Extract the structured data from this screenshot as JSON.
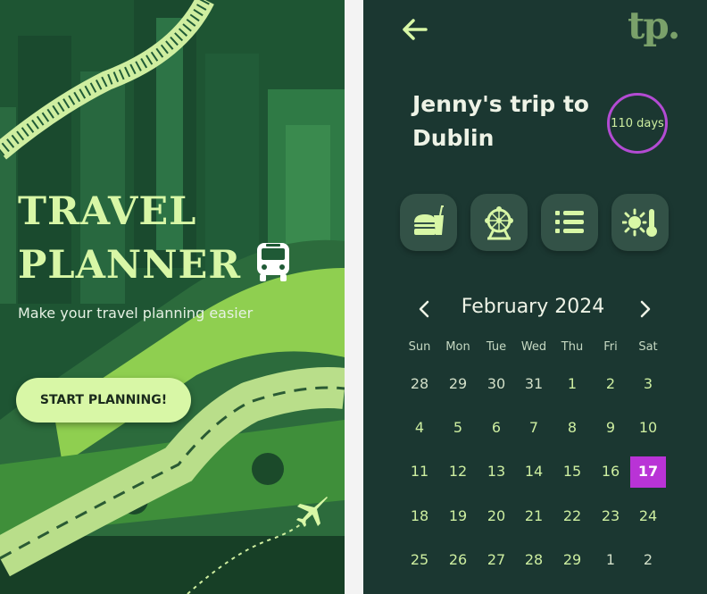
{
  "poster": {
    "title_line1": "TRAVEL",
    "title_line2": "PLANNER",
    "subtitle": "Make your travel planning easier",
    "cta_label": "START PLANNING!",
    "icons": [
      "bus-icon",
      "airplane-icon"
    ]
  },
  "app": {
    "logo": "tp.",
    "trip_title": "Jenny's trip to Dublin",
    "countdown": "110 days",
    "categories": [
      {
        "name": "food",
        "icon": "burger-drink-icon"
      },
      {
        "name": "attractions",
        "icon": "ferris-wheel-icon"
      },
      {
        "name": "list",
        "icon": "list-icon"
      },
      {
        "name": "weather",
        "icon": "sun-thermometer-icon"
      }
    ],
    "calendar": {
      "month_label": "February 2024",
      "weekdays": [
        "Sun",
        "Mon",
        "Tue",
        "Wed",
        "Thu",
        "Fri",
        "Sat"
      ],
      "weeks": [
        [
          "28",
          "29",
          "30",
          "31",
          "1",
          "2",
          "3"
        ],
        [
          "4",
          "5",
          "6",
          "7",
          "8",
          "9",
          "10"
        ],
        [
          "11",
          "12",
          "13",
          "14",
          "15",
          "16",
          "17"
        ],
        [
          "18",
          "19",
          "20",
          "21",
          "22",
          "23",
          "24"
        ],
        [
          "25",
          "26",
          "27",
          "28",
          "29",
          "1",
          "2"
        ]
      ],
      "selected_day": "17"
    }
  },
  "colors": {
    "accent_green": "#d8f7a6",
    "panel_bg": "#1b3731",
    "selected": "#b933d6",
    "badge_ring": "#b34bd3"
  }
}
